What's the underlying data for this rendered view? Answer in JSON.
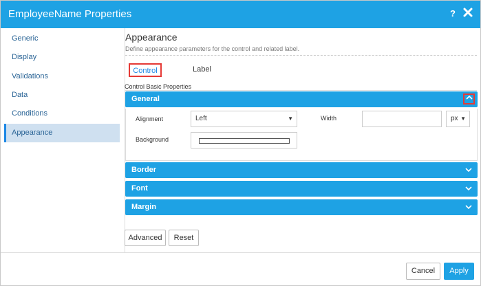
{
  "dialog": {
    "title": "EmployeeName Properties",
    "help_label": "?",
    "accent_color": "#1ea2e4"
  },
  "sidebar": {
    "items": [
      {
        "label": "Generic"
      },
      {
        "label": "Display"
      },
      {
        "label": "Validations"
      },
      {
        "label": "Data"
      },
      {
        "label": "Conditions"
      },
      {
        "label": "Appearance"
      }
    ],
    "active": "Appearance"
  },
  "main": {
    "title": "Appearance",
    "description": "Define appearance parameters for the control and related label.",
    "tabs": [
      {
        "label": "Control"
      },
      {
        "label": "Label"
      }
    ],
    "basic_label": "Control Basic Properties",
    "panels": {
      "general": {
        "title": "General",
        "expanded": true
      },
      "border": {
        "title": "Border"
      },
      "font": {
        "title": "Font"
      },
      "margin": {
        "title": "Margin"
      }
    },
    "fields": {
      "alignment_label": "Alignment",
      "alignment_value": "Left",
      "width_label": "Width",
      "width_value": "",
      "unit_value": "px",
      "background_label": "Background"
    },
    "buttons": {
      "advanced": "Advanced",
      "reset": "Reset"
    }
  },
  "footer": {
    "cancel": "Cancel",
    "apply": "Apply"
  }
}
